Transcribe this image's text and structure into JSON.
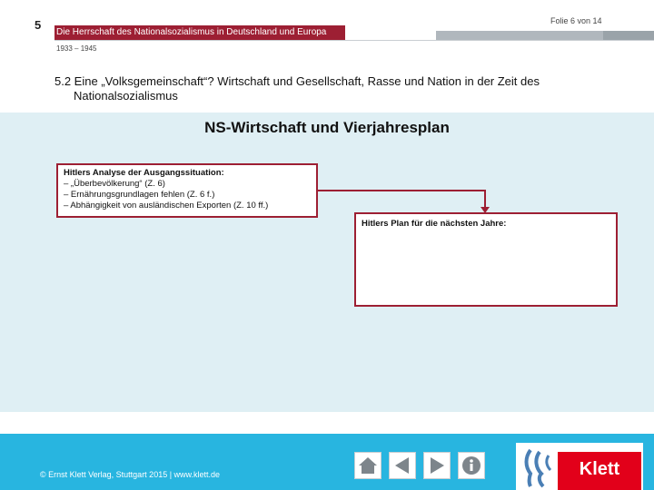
{
  "header": {
    "chapter": "5",
    "slide_counter": "Folie 6 von 14",
    "title": "Die Herrschaft des Nationalsozialismus in Deutschland und Europa",
    "years": "1933 – 1945"
  },
  "section": {
    "heading_line1": "5.2 Eine „Volksgemeinschaft“? Wirtschaft und Gesellschaft, Rasse und Nation in der Zeit des",
    "heading_line2": "Nationalsozialismus"
  },
  "panel": {
    "title": "NS-Wirtschaft und Vierjahresplan",
    "analysis_box": {
      "title": "Hitlers Analyse der Ausgangssituation:",
      "items": [
        "– „Überbevölkerung“ (Z. 6)",
        "– Ernährungsgrundlagen fehlen (Z. 6 f.)",
        "– Abhängigkeit von ausländischen Exporten (Z. 10 ff.)"
      ]
    },
    "plan_box": {
      "title": "Hitlers Plan für die nächsten Jahre:"
    }
  },
  "footer": {
    "copyright": "© Ernst Klett Verlag, Stuttgart 2015 | www.klett.de",
    "nav_icons": [
      "home-icon",
      "previous-icon",
      "next-icon",
      "info-icon"
    ],
    "logo_text": "Klett"
  },
  "colors": {
    "accent": "#9d1f33",
    "panel": "#dfeff4",
    "footer": "#28b5e0",
    "logo_red": "#e2001a"
  }
}
